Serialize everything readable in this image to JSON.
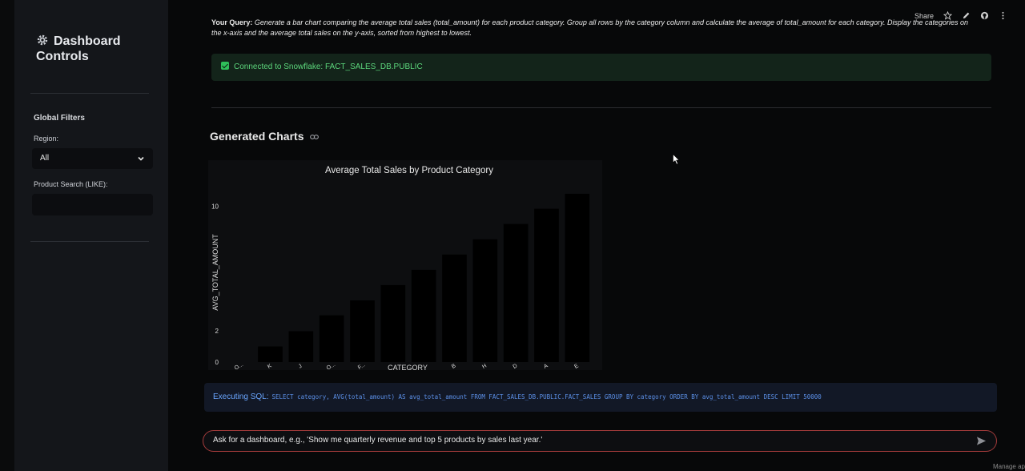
{
  "sidebar": {
    "title_line1": "Dashboard",
    "title_line2": "Controls",
    "global_filters": "Global Filters",
    "region_label": "Region:",
    "region_value": "All",
    "product_search_label": "Product Search (LIKE):",
    "product_search_value": ""
  },
  "topbar": {
    "share": "Share"
  },
  "query": {
    "label": "Your Query:",
    "text": "Generate a bar chart comparing the average total sales (total_amount) for each product category. Group all rows by the category column and calculate the average of total_amount for each category. Display the categories on the x-axis and the average total sales on the y-axis, sorted from highest to lowest."
  },
  "connection": {
    "message": "Connected to Snowflake: FACT_SALES_DB.PUBLIC"
  },
  "charts_section": {
    "title": "Generated Charts"
  },
  "chart_data": {
    "type": "bar",
    "title": "Average Total Sales by Product Category",
    "xlabel": "CATEGORY",
    "ylabel": "AVG_TOTAL_AMOUNT",
    "yticks": [
      0,
      2,
      10
    ],
    "ylim": [
      0,
      10.9
    ],
    "categories": [
      "O..",
      "K",
      "J",
      "C",
      "F..",
      "I",
      "B",
      "H",
      "D",
      "A",
      "E",
      "G"
    ],
    "tick_labels": [
      "O...",
      "K",
      "J",
      "O...",
      "F...",
      "",
      "",
      "B",
      "H",
      "D",
      "A",
      "E"
    ],
    "values": [
      0.0,
      1.0,
      1.98,
      3.0,
      3.96,
      4.94,
      5.92,
      6.9,
      7.88,
      8.86,
      9.84,
      10.8
    ],
    "bar_color": "#000000",
    "background": "#0d0e10"
  },
  "sql": {
    "label": "Executing SQL:",
    "code": "SELECT category, AVG(total_amount) AS avg_total_amount FROM FACT_SALES_DB.PUBLIC.FACT_SALES GROUP BY category ORDER BY avg_total_amount DESC LIMIT 50000"
  },
  "chat": {
    "value": "Ask for a dashboard, e.g., 'Show me quarterly revenue and top 5 products by sales last year.'"
  },
  "footer": {
    "manage": "Manage ap"
  }
}
